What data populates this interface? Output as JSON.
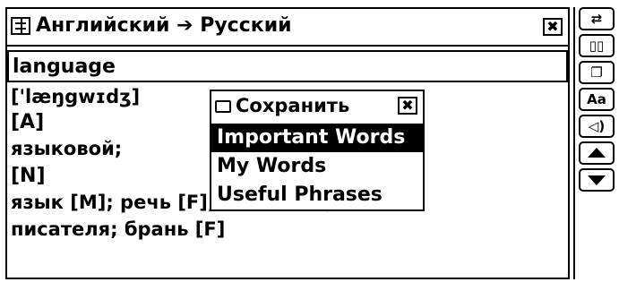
{
  "window": {
    "title": "Английский ➔ Русский",
    "title_icon": "dictionary-book-icon",
    "close_label": "✖"
  },
  "search": {
    "value": "language"
  },
  "entry": {
    "transcription": "['læŋgwɪdʒ]",
    "pos_adjective": "[A]",
    "translation_adjective": "языковой;",
    "pos_noun": "[N]",
    "line_noun_1": "язык [M]; речь [F]; стиль [M]; язык",
    "line_noun_2": "писателя; брань [F]"
  },
  "save_menu": {
    "title": "Сохранить",
    "icon": "folder-icon",
    "close_label": "✖",
    "items": [
      {
        "label": "Important Words",
        "selected": true
      },
      {
        "label": "My Words",
        "selected": false
      },
      {
        "label": "Useful Phrases",
        "selected": false
      }
    ]
  },
  "toolbar": {
    "buttons": [
      {
        "name": "switch-direction-icon",
        "label": "⇄"
      },
      {
        "name": "book-icon",
        "label": "▯▯"
      },
      {
        "name": "windows-icon",
        "label": "❐"
      },
      {
        "name": "font-size-icon",
        "label": "Aa"
      },
      {
        "name": "speaker-icon",
        "label": "◁)"
      },
      {
        "name": "arrow-up-icon",
        "label": ""
      },
      {
        "name": "arrow-down-icon",
        "label": ""
      }
    ]
  }
}
